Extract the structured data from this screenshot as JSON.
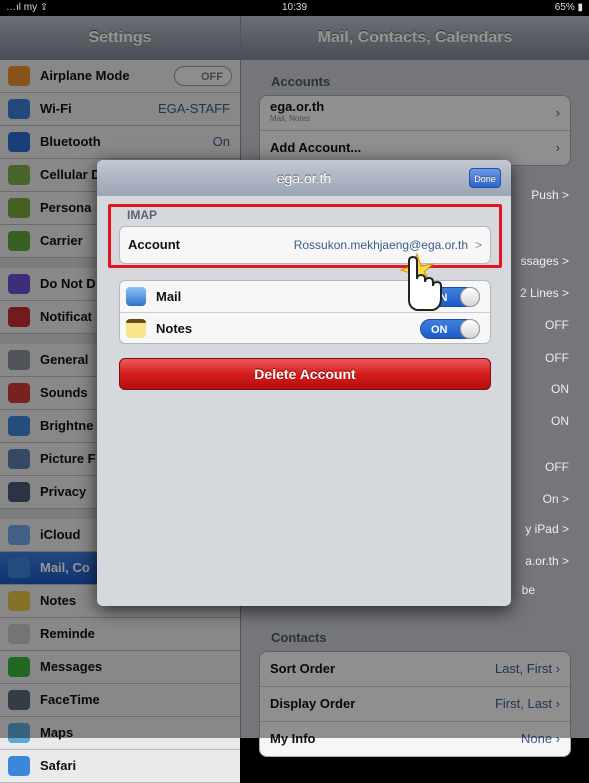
{
  "status": {
    "carrier": "…ıl my ⇪",
    "time": "10:39",
    "battery": "65% ▮"
  },
  "left": {
    "title": "Settings",
    "items": [
      {
        "label": "Airplane Mode",
        "value": "OFF",
        "toggle": true,
        "color": "#e88f2d"
      },
      {
        "label": "Wi-Fi",
        "value": "EGA-STAFF",
        "color": "#3d7ed6"
      },
      {
        "label": "Bluetooth",
        "value": "On",
        "color": "#2e6bd1"
      },
      {
        "label": "Cellular D",
        "value": "",
        "color": "#7db04a"
      },
      {
        "label": "Persona",
        "value": "",
        "color": "#76a540"
      },
      {
        "label": "Carrier",
        "value": "",
        "color": "#5fa641"
      },
      {
        "label": "Do Not D",
        "value": "",
        "color": "#6a4fd3"
      },
      {
        "label": "Notificat",
        "value": "",
        "color": "#c62d2d"
      },
      {
        "label": "General",
        "value": "",
        "color": "#8a8f99"
      },
      {
        "label": "Sounds",
        "value": "",
        "color": "#d03939"
      },
      {
        "label": "Brightne",
        "value": "",
        "color": "#3c86d8"
      },
      {
        "label": "Picture F",
        "value": "",
        "color": "#5a7fb0"
      },
      {
        "label": "Privacy",
        "value": "",
        "color": "#4a5b78"
      },
      {
        "label": "iCloud",
        "value": "",
        "color": "#6ea6e6"
      },
      {
        "label": "Mail, Co",
        "value": "",
        "color": "#3e84da"
      },
      {
        "label": "Notes",
        "value": "",
        "color": "#e6c548"
      },
      {
        "label": "Reminde",
        "value": "",
        "color": "#c9c9c9"
      },
      {
        "label": "Messages",
        "value": "",
        "color": "#3bb13b"
      },
      {
        "label": "FaceTime",
        "value": "",
        "color": "#5a6a7a"
      },
      {
        "label": "Maps",
        "value": "",
        "color": "#5ca9d9"
      },
      {
        "label": "Safari",
        "value": "",
        "color": "#3a89d9"
      }
    ]
  },
  "right": {
    "title": "Mail, Contacts, Calendars",
    "accounts_header": "Accounts",
    "accounts": [
      {
        "title": "ega.or.th",
        "sub": "Mail, Notes"
      },
      {
        "title": "Add Account..."
      }
    ],
    "peek": [
      "Push >",
      "ssages >",
      "2 Lines >",
      "OFF",
      "OFF",
      "ON",
      "ON",
      "OFF",
      "On >",
      "y iPad >",
      "a.or.th >",
      "be"
    ],
    "contacts_header": "Contacts",
    "contacts": [
      {
        "label": "Sort Order",
        "value": "Last, First"
      },
      {
        "label": "Display Order",
        "value": "First, Last"
      },
      {
        "label": "My Info",
        "value": "None"
      }
    ]
  },
  "modal": {
    "title": "ega.or.th",
    "done": "Done",
    "section": "IMAP",
    "account_label": "Account",
    "account_value": "Rossukon.mekhjaeng@ega.or.th",
    "chevron": ">",
    "services": [
      {
        "label": "Mail",
        "state": "ON",
        "color": "#4a8fe0"
      },
      {
        "label": "Notes",
        "state": "ON",
        "color": "#e9c84a"
      }
    ],
    "delete": "Delete Account"
  }
}
